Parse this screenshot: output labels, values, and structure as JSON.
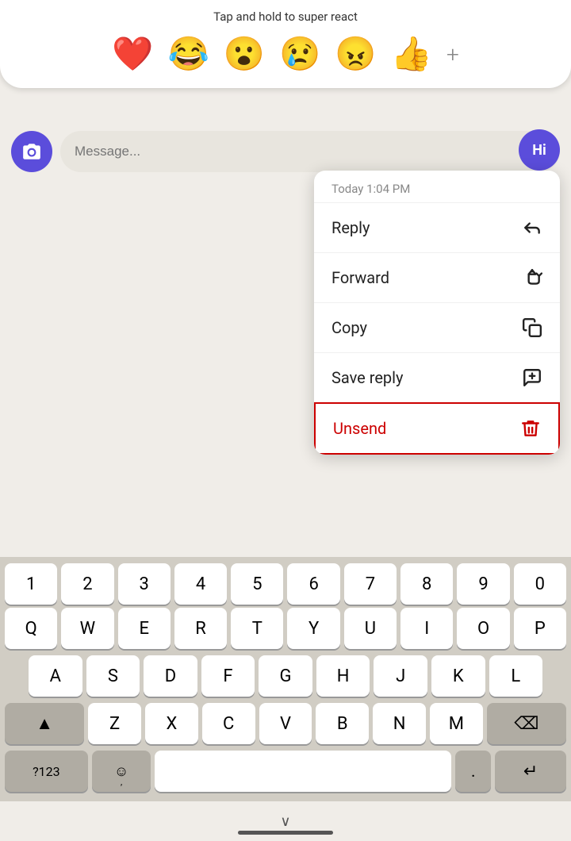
{
  "emoji_bar": {
    "tap_hold_text": "Tap and hold to super react",
    "emojis": [
      "❤️",
      "😂",
      "😮",
      "😢",
      "😠",
      "👍"
    ],
    "plus_label": "+"
  },
  "message_input": {
    "placeholder": "Message..."
  },
  "hi_bubble": {
    "label": "Hi"
  },
  "context_menu": {
    "timestamp": "Today 1:04 PM",
    "items": [
      {
        "id": "reply",
        "label": "Reply"
      },
      {
        "id": "forward",
        "label": "Forward"
      },
      {
        "id": "copy",
        "label": "Copy"
      },
      {
        "id": "save_reply",
        "label": "Save reply"
      },
      {
        "id": "unsend",
        "label": "Unsend"
      }
    ]
  },
  "keyboard": {
    "number_row": [
      "1",
      "2",
      "3",
      "4",
      "5",
      "6",
      "7",
      "8",
      "9",
      "0"
    ],
    "row_q": [
      "Q",
      "W",
      "E",
      "R",
      "T",
      "Y",
      "U",
      "I",
      "O",
      "P"
    ],
    "row_a": [
      "A",
      "S",
      "D",
      "F",
      "G",
      "H",
      "J",
      "K",
      "L"
    ],
    "row_z": [
      "Z",
      "X",
      "C",
      "V",
      "B",
      "N",
      "M"
    ],
    "special_keys": {
      "shift": "▲",
      "backspace": "⌫",
      "numbers": "?123",
      "emoji": "☺",
      "comma": ",",
      "space": "",
      "period": ".",
      "enter": "↵"
    }
  },
  "colors": {
    "purple": "#5b4ddb",
    "red": "#cc0000",
    "key_bg": "#ffffff",
    "dark_key_bg": "#b0aca3",
    "keyboard_bg": "#d1cdc4"
  }
}
